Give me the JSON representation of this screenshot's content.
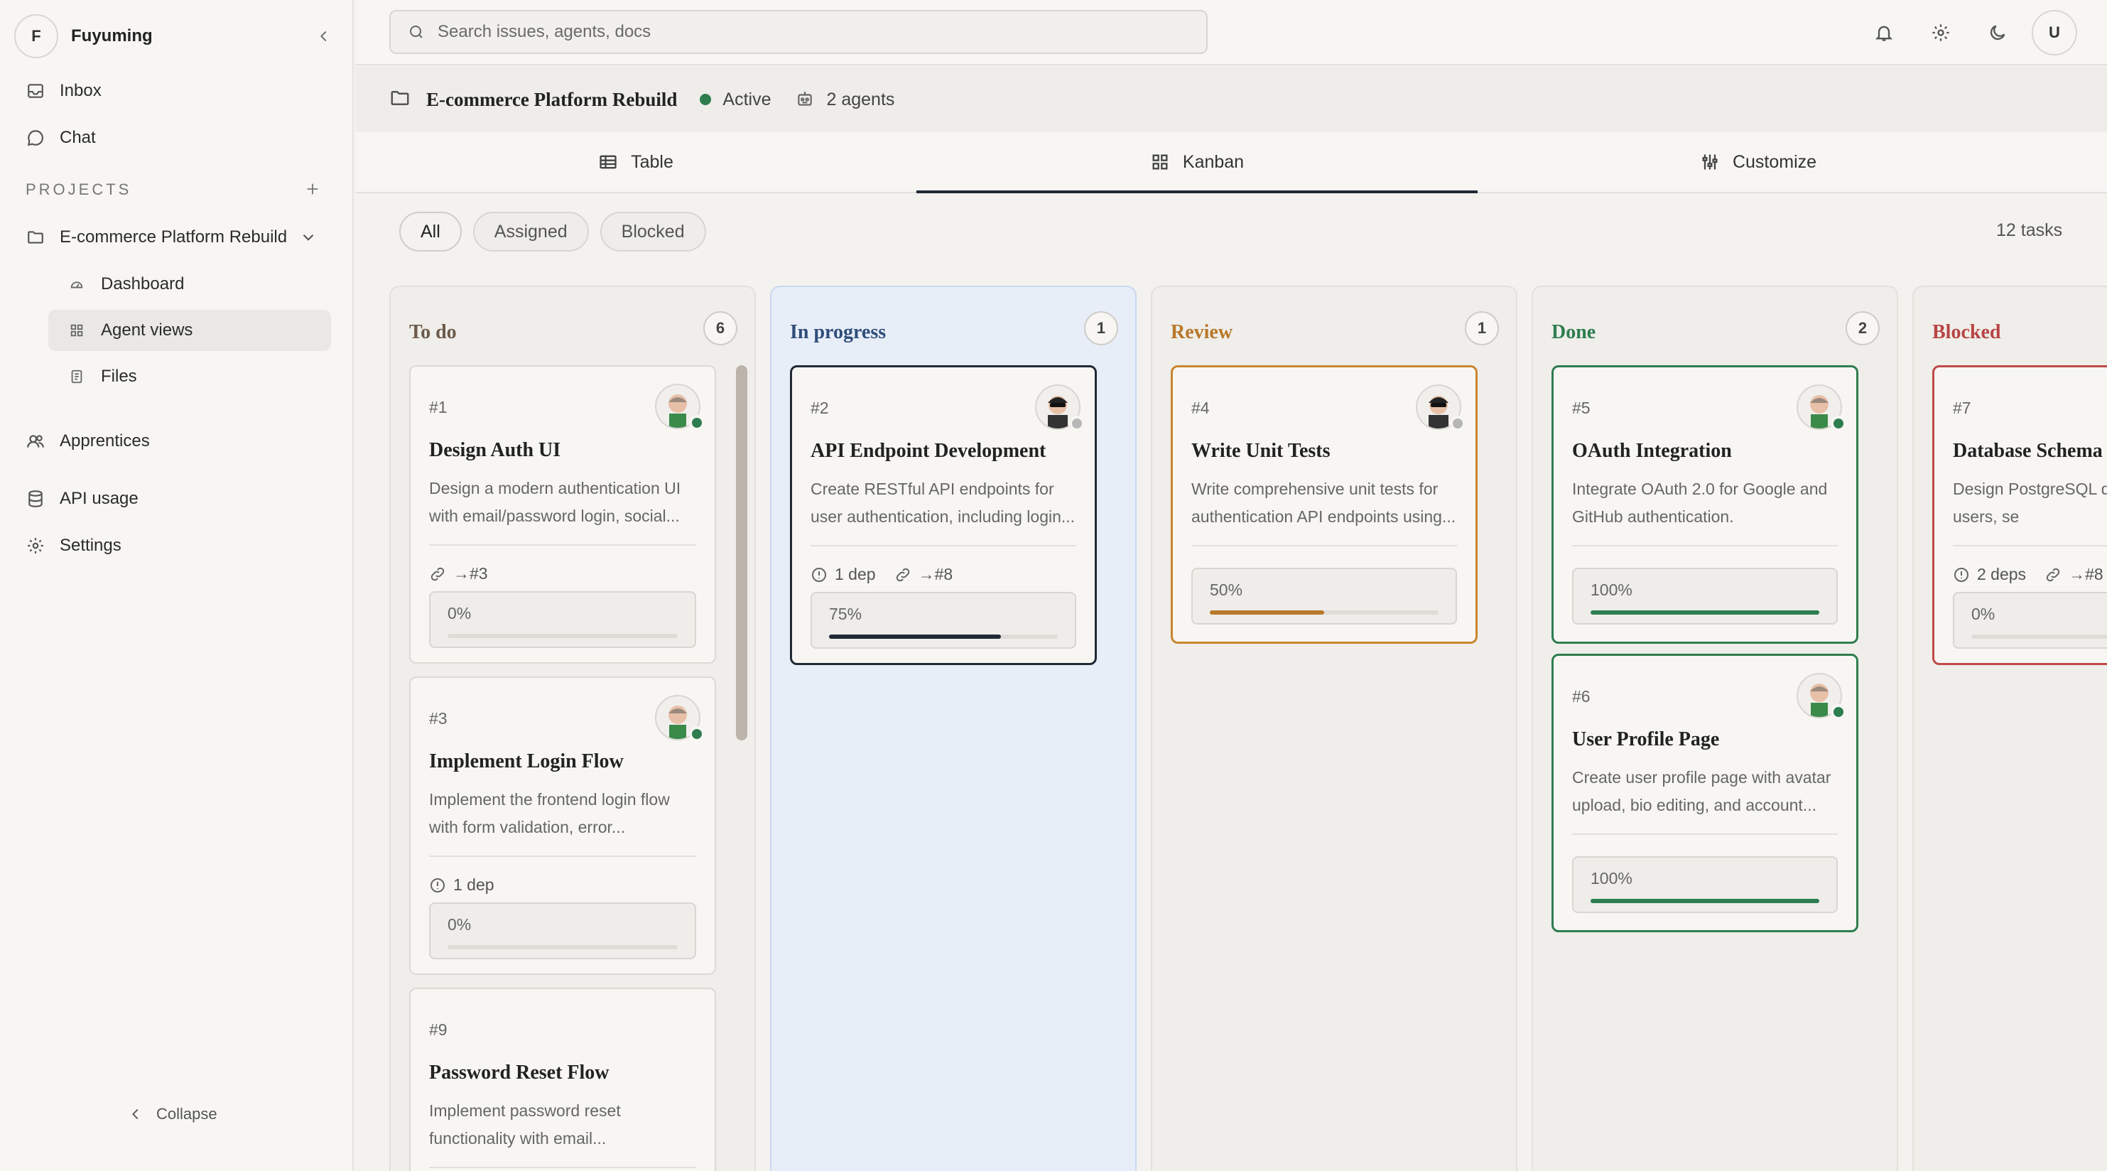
{
  "sidebar": {
    "workspace_initial": "F",
    "workspace_name": "Fuyuming",
    "nav": [
      {
        "label": "Inbox",
        "icon": "inbox-icon"
      },
      {
        "label": "Chat",
        "icon": "chat-icon"
      }
    ],
    "projects_label": "PROJECTS",
    "project_name": "E-commerce Platform Rebuild",
    "project_sub": [
      {
        "label": "Dashboard",
        "icon": "dashboard-icon"
      },
      {
        "label": "Agent views",
        "icon": "grid-icon"
      },
      {
        "label": "Files",
        "icon": "files-icon"
      }
    ],
    "bottom_nav": [
      {
        "label": "Apprentices",
        "icon": "people-icon"
      },
      {
        "label": "API usage",
        "icon": "database-icon"
      },
      {
        "label": "Settings",
        "icon": "gear-icon"
      }
    ],
    "collapse_label": "Collapse"
  },
  "topbar": {
    "search_placeholder": "Search issues, agents, docs",
    "user_initial": "U"
  },
  "project_header": {
    "title": "E-commerce Platform Rebuild",
    "status": "Active",
    "status_color": "#2e7d4f",
    "agents": "2 agents"
  },
  "tabs": [
    {
      "label": "Table",
      "icon": "table-icon"
    },
    {
      "label": "Kanban",
      "icon": "grid-icon",
      "active": true
    },
    {
      "label": "Customize",
      "icon": "sliders-icon"
    }
  ],
  "filters": [
    "All",
    "Assigned",
    "Blocked"
  ],
  "task_count": "12 tasks",
  "columns": [
    {
      "title": "To do",
      "count": "6",
      "color": "#6b5a4a",
      "cards": [
        {
          "id": "#1",
          "title": "Design Auth UI",
          "desc": "Design a modern authentication UI with email/password login, social...",
          "link": "→#3",
          "progress_label": "0%",
          "progress": 0
        },
        {
          "id": "#3",
          "title": "Implement Login Flow",
          "desc": "Implement the frontend login flow with form validation, error...",
          "deps": "1 dep",
          "progress_label": "0%",
          "progress": 0
        },
        {
          "id": "#9",
          "title": "Password Reset Flow",
          "desc": "Implement password reset functionality with email..."
        }
      ]
    },
    {
      "title": "In progress",
      "count": "1",
      "color": "#2f4d7a",
      "cards": [
        {
          "id": "#2",
          "title": "API Endpoint Development",
          "desc": "Create RESTful API endpoints for user authentication, including login...",
          "deps": "1 dep",
          "link": "→#8",
          "progress_label": "75%",
          "progress": 0.75
        }
      ]
    },
    {
      "title": "Review",
      "count": "1",
      "color": "#b8782a",
      "cards": [
        {
          "id": "#4",
          "title": "Write Unit Tests",
          "desc": "Write comprehensive unit tests for authentication API endpoints using...",
          "progress_label": "50%",
          "progress": 0.5
        }
      ]
    },
    {
      "title": "Done",
      "count": "2",
      "color": "#2e7d4f",
      "cards": [
        {
          "id": "#5",
          "title": "OAuth Integration",
          "desc": "Integrate OAuth 2.0 for Google and GitHub authentication.",
          "progress_label": "100%",
          "progress": 1
        },
        {
          "id": "#6",
          "title": "User Profile Page",
          "desc": "Create user profile page with avatar upload, bio editing, and account...",
          "progress_label": "100%",
          "progress": 1
        }
      ]
    },
    {
      "title": "Blocked",
      "color": "#b84444",
      "cards": [
        {
          "id": "#7",
          "title": "Database Schema",
          "desc": "Design PostgreSQL d schema for users, se",
          "deps": "2 deps",
          "link": "→#8",
          "progress_label": "0%",
          "progress": 0
        }
      ]
    }
  ]
}
